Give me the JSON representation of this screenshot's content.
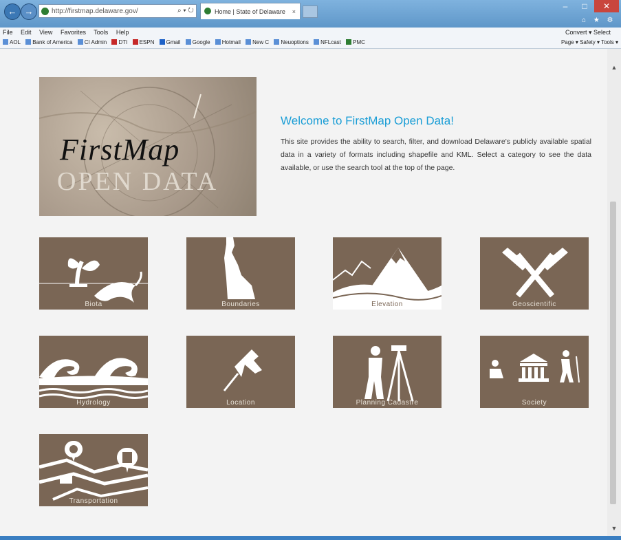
{
  "browser": {
    "address": "http://firstmap.delaware.gov/",
    "address_tools": "⌕ ▾ ↻",
    "tab_title": "Home | State of Delaware",
    "tab_close": "×",
    "back": "←",
    "forward": "→",
    "min": "–",
    "max": "□",
    "close": "✕",
    "right_icons": "⌂ ★ ⚙"
  },
  "menubar": {
    "items": [
      "File",
      "Edit",
      "View",
      "Favorites",
      "Tools",
      "Help"
    ],
    "convert": "Convert ▾   Select"
  },
  "favorites": {
    "items": [
      {
        "label": "AOL",
        "icon": "aol-icon"
      },
      {
        "label": "Bank of America",
        "icon": "page-icon"
      },
      {
        "label": "CI Admin",
        "icon": "page-icon"
      },
      {
        "label": "DTI",
        "icon": "dti-icon"
      },
      {
        "label": "ESPN",
        "icon": "espn-icon"
      },
      {
        "label": "Gmail",
        "icon": "gmail-icon"
      },
      {
        "label": "Google",
        "icon": "page-icon"
      },
      {
        "label": "Hotmail",
        "icon": "page-icon"
      },
      {
        "label": "New C",
        "icon": "page-icon"
      },
      {
        "label": "Neuoptions",
        "icon": "page-icon"
      },
      {
        "label": "NFLcast",
        "icon": "page-icon"
      },
      {
        "label": "PMC",
        "icon": "page-icon"
      }
    ],
    "right": "Page ▾  Safety ▾  Tools ▾"
  },
  "hero": {
    "title": "FirstMap",
    "subtitle": "OPEN DATA"
  },
  "welcome": {
    "heading": "Welcome to FirstMap Open Data!",
    "body": "This site provides the ability to search, filter, and download Delaware's publicly available spatial data in a variety of formats including shapefile and KML. Select a category to see the data available, or use the search tool at the top of the page."
  },
  "categories": [
    {
      "label": "Biota",
      "icon": "plant-fish-icon"
    },
    {
      "label": "Boundaries",
      "icon": "delaware-map-icon"
    },
    {
      "label": "Elevation",
      "icon": "mountains-icon"
    },
    {
      "label": "Geoscientific",
      "icon": "hammers-icon"
    },
    {
      "label": "Hydrology",
      "icon": "waves-icon"
    },
    {
      "label": "Location",
      "icon": "pushpin-icon"
    },
    {
      "label": "Planning Cadastre",
      "icon": "surveyor-icon"
    },
    {
      "label": "Society",
      "icon": "society-icon"
    },
    {
      "label": "Transportation",
      "icon": "transit-map-icon"
    }
  ],
  "scroll": {
    "up": "▲",
    "down": "▼"
  },
  "colors": {
    "tile": "#7a6655",
    "accent": "#1b9ed6"
  }
}
